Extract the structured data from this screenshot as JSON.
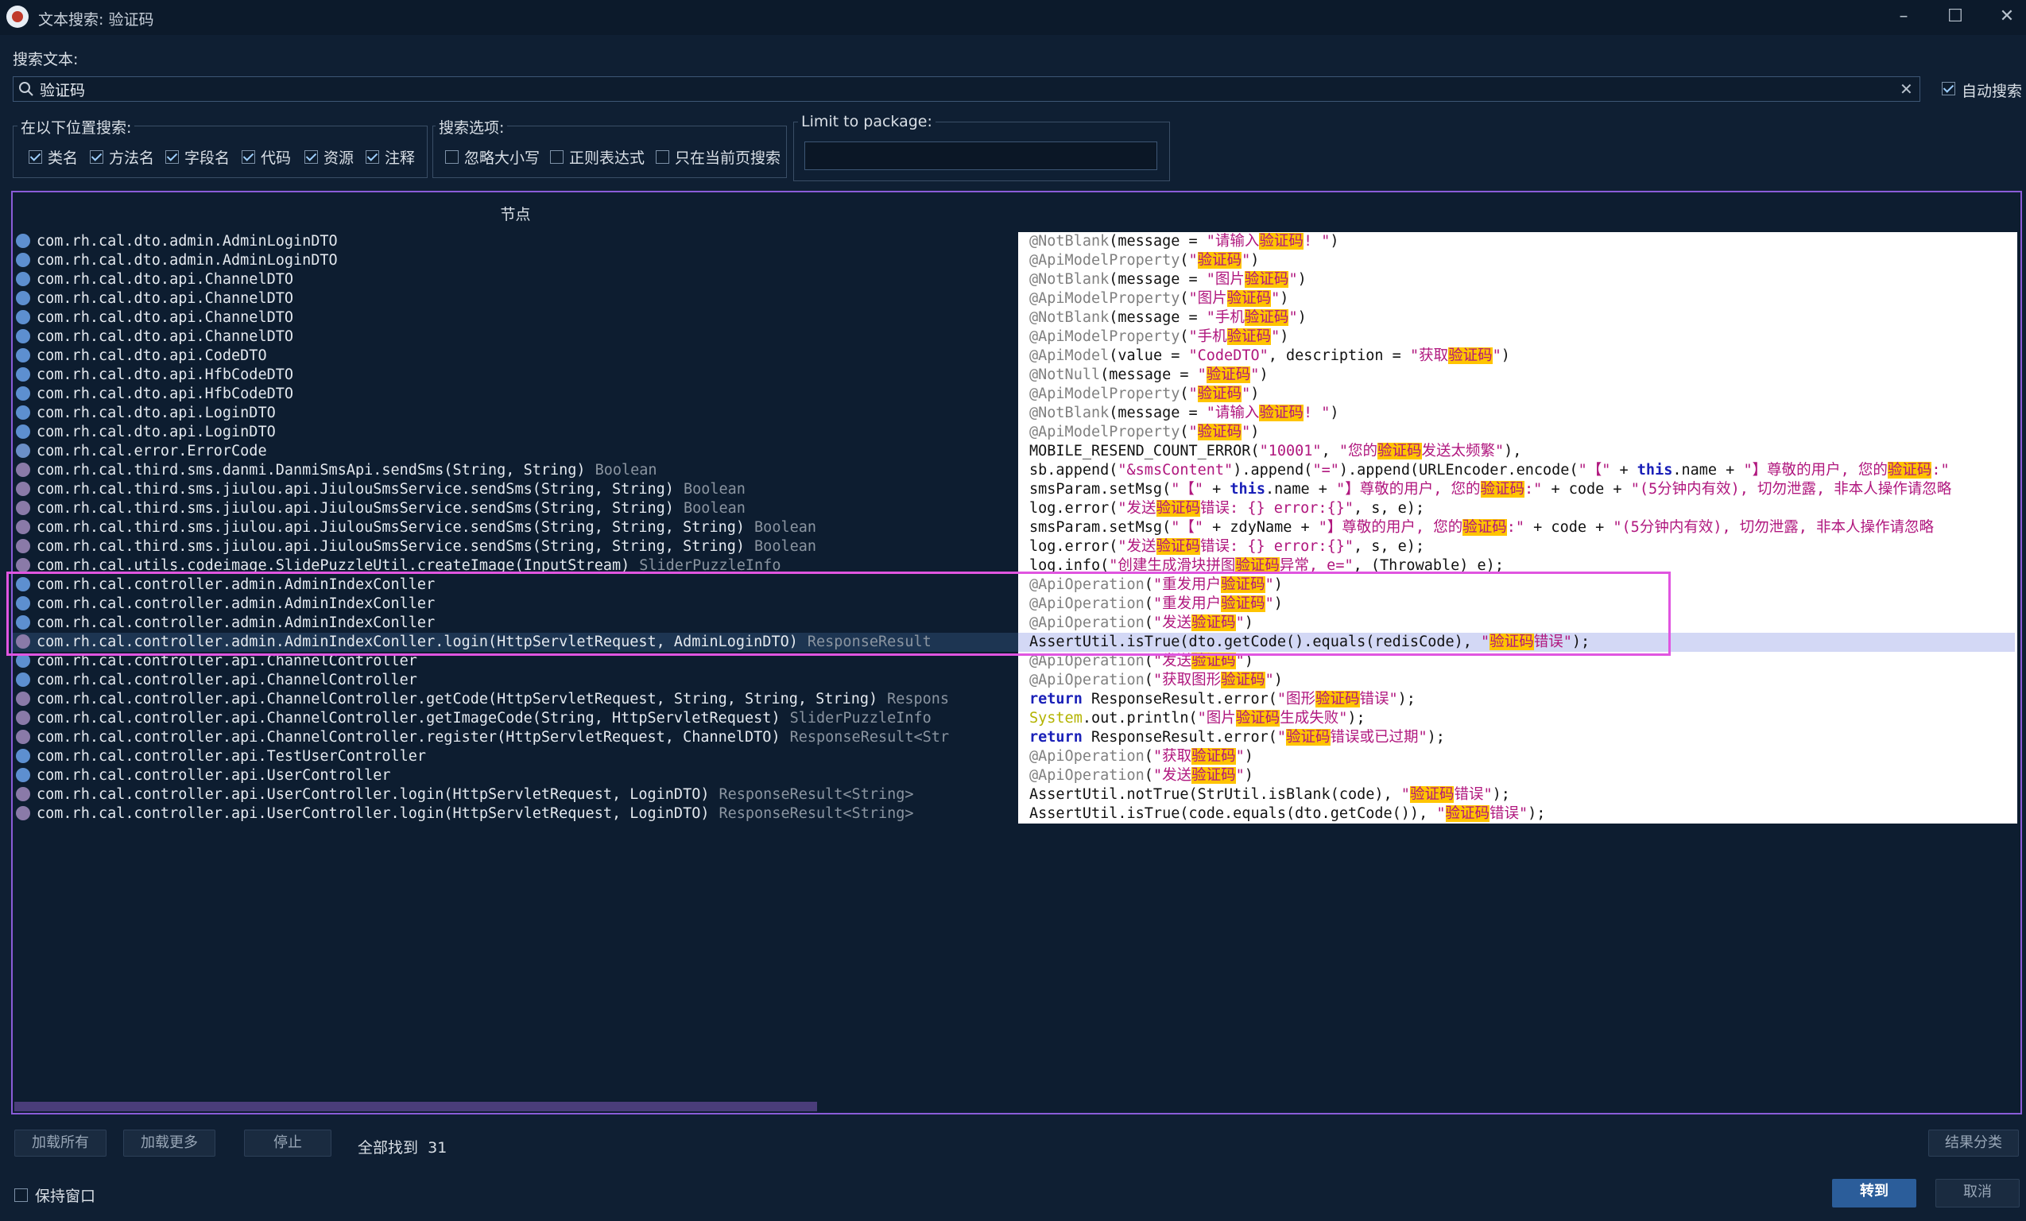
{
  "window": {
    "title": "文本搜索: 验证码"
  },
  "search": {
    "label": "搜索文本:",
    "value": "验证码",
    "auto_search_label": "自动搜索",
    "auto_search_checked": true
  },
  "search_in": {
    "legend": "在以下位置搜索:",
    "options": [
      {
        "label": "类名",
        "checked": true
      },
      {
        "label": "方法名",
        "checked": true
      },
      {
        "label": "字段名",
        "checked": true
      },
      {
        "label": "代码",
        "checked": true
      },
      {
        "label": "资源",
        "checked": true
      },
      {
        "label": "注释",
        "checked": true
      }
    ]
  },
  "search_options": {
    "legend": "搜索选项:",
    "options": [
      {
        "label": "忽略大小写",
        "checked": false
      },
      {
        "label": "正则表达式",
        "checked": false
      },
      {
        "label": "只在当前页搜索",
        "checked": false
      }
    ]
  },
  "package_filter": {
    "legend": "Limit to package:",
    "value": ""
  },
  "results": {
    "column_header": "节点",
    "rows": [
      {
        "icon": "class-icon",
        "node": "com.rh.cal.dto.admin.AdminLoginDTO",
        "ret": ""
      },
      {
        "icon": "class-icon",
        "node": "com.rh.cal.dto.admin.AdminLoginDTO",
        "ret": ""
      },
      {
        "icon": "class-icon",
        "node": "com.rh.cal.dto.api.ChannelDTO",
        "ret": ""
      },
      {
        "icon": "class-icon",
        "node": "com.rh.cal.dto.api.ChannelDTO",
        "ret": ""
      },
      {
        "icon": "class-icon",
        "node": "com.rh.cal.dto.api.ChannelDTO",
        "ret": ""
      },
      {
        "icon": "class-icon",
        "node": "com.rh.cal.dto.api.ChannelDTO",
        "ret": ""
      },
      {
        "icon": "class-icon",
        "node": "com.rh.cal.dto.api.CodeDTO",
        "ret": ""
      },
      {
        "icon": "class-icon",
        "node": "com.rh.cal.dto.api.HfbCodeDTO",
        "ret": ""
      },
      {
        "icon": "class-icon",
        "node": "com.rh.cal.dto.api.HfbCodeDTO",
        "ret": ""
      },
      {
        "icon": "class-icon",
        "node": "com.rh.cal.dto.api.LoginDTO",
        "ret": ""
      },
      {
        "icon": "class-icon",
        "node": "com.rh.cal.dto.api.LoginDTO",
        "ret": ""
      },
      {
        "icon": "enum-icon",
        "node": "com.rh.cal.error.ErrorCode",
        "ret": ""
      },
      {
        "icon": "method-icon",
        "node": "com.rh.cal.third.sms.danmi.DanmiSmsApi.sendSms(String, String)",
        "ret": "Boolean"
      },
      {
        "icon": "method-icon",
        "node": "com.rh.cal.third.sms.jiulou.api.JiulouSmsService.sendSms(String, String)",
        "ret": "Boolean"
      },
      {
        "icon": "method-icon",
        "node": "com.rh.cal.third.sms.jiulou.api.JiulouSmsService.sendSms(String, String)",
        "ret": "Boolean"
      },
      {
        "icon": "method-icon",
        "node": "com.rh.cal.third.sms.jiulou.api.JiulouSmsService.sendSms(String, String, String)",
        "ret": "Boolean"
      },
      {
        "icon": "method-icon",
        "node": "com.rh.cal.third.sms.jiulou.api.JiulouSmsService.sendSms(String, String, String)",
        "ret": "Boolean"
      },
      {
        "icon": "method-icon",
        "node": "com.rh.cal.utils.codeimage.SlidePuzzleUtil.createImage(InputStream)",
        "ret": "SliderPuzzleInfo"
      },
      {
        "icon": "class-icon",
        "node": "com.rh.cal.controller.admin.AdminIndexConller",
        "ret": ""
      },
      {
        "icon": "class-icon",
        "node": "com.rh.cal.controller.admin.AdminIndexConller",
        "ret": ""
      },
      {
        "icon": "class-icon",
        "node": "com.rh.cal.controller.admin.AdminIndexConller",
        "ret": ""
      },
      {
        "icon": "method-icon",
        "node": "com.rh.cal.controller.admin.AdminIndexConller.login(HttpServletRequest, AdminLoginDTO)",
        "ret": "ResponseResult"
      },
      {
        "icon": "class-icon",
        "node": "com.rh.cal.controller.api.ChannelController",
        "ret": ""
      },
      {
        "icon": "class-icon",
        "node": "com.rh.cal.controller.api.ChannelController",
        "ret": ""
      },
      {
        "icon": "method-icon",
        "node": "com.rh.cal.controller.api.ChannelController.getCode(HttpServletRequest, String, String, String)",
        "ret": "Respons"
      },
      {
        "icon": "method-icon",
        "node": "com.rh.cal.controller.api.ChannelController.getImageCode(String, HttpServletRequest)",
        "ret": "SliderPuzzleInfo"
      },
      {
        "icon": "method-icon",
        "node": "com.rh.cal.controller.api.ChannelController.register(HttpServletRequest, ChannelDTO)",
        "ret": "ResponseResult<Str"
      },
      {
        "icon": "class-icon",
        "node": "com.rh.cal.controller.api.TestUserController",
        "ret": ""
      },
      {
        "icon": "class-icon",
        "node": "com.rh.cal.controller.api.UserController",
        "ret": ""
      },
      {
        "icon": "method-icon",
        "node": "com.rh.cal.controller.api.UserController.login(HttpServletRequest, LoginDTO)",
        "ret": "ResponseResult<String>"
      },
      {
        "icon": "method-icon",
        "node": "com.rh.cal.controller.api.UserController.login(HttpServletRequest, LoginDTO)",
        "ret": "ResponseResult<String>"
      }
    ],
    "selected_index": 21,
    "code_lines": [
      [
        [
          "ann",
          "@NotBlank"
        ],
        [
          "n",
          "(message = "
        ],
        [
          "str",
          "\"请输入"
        ],
        [
          "hl",
          "验证码"
        ],
        [
          "str",
          "! \""
        ],
        [
          "n",
          ")"
        ]
      ],
      [
        [
          "ann",
          "@ApiModelProperty"
        ],
        [
          "n",
          "("
        ],
        [
          "str",
          "\""
        ],
        [
          "hl",
          "验证码"
        ],
        [
          "str",
          "\""
        ],
        [
          "n",
          ")"
        ]
      ],
      [
        [
          "ann",
          "@NotBlank"
        ],
        [
          "n",
          "(message = "
        ],
        [
          "str",
          "\"图片"
        ],
        [
          "hl",
          "验证码"
        ],
        [
          "str",
          "\""
        ],
        [
          "n",
          ")"
        ]
      ],
      [
        [
          "ann",
          "@ApiModelProperty"
        ],
        [
          "n",
          "("
        ],
        [
          "str",
          "\"图片"
        ],
        [
          "hl",
          "验证码"
        ],
        [
          "str",
          "\""
        ],
        [
          "n",
          ")"
        ]
      ],
      [
        [
          "ann",
          "@NotBlank"
        ],
        [
          "n",
          "(message = "
        ],
        [
          "str",
          "\"手机"
        ],
        [
          "hl",
          "验证码"
        ],
        [
          "str",
          "\""
        ],
        [
          "n",
          ")"
        ]
      ],
      [
        [
          "ann",
          "@ApiModelProperty"
        ],
        [
          "n",
          "("
        ],
        [
          "str",
          "\"手机"
        ],
        [
          "hl",
          "验证码"
        ],
        [
          "str",
          "\""
        ],
        [
          "n",
          ")"
        ]
      ],
      [
        [
          "ann",
          "@ApiModel"
        ],
        [
          "n",
          "(value = "
        ],
        [
          "str",
          "\"CodeDTO\""
        ],
        [
          "n",
          ", description = "
        ],
        [
          "str",
          "\"获取"
        ],
        [
          "hl",
          "验证码"
        ],
        [
          "str",
          "\""
        ],
        [
          "n",
          ")"
        ]
      ],
      [
        [
          "ann",
          "@NotNull"
        ],
        [
          "n",
          "(message = "
        ],
        [
          "str",
          "\""
        ],
        [
          "hl",
          "验证码"
        ],
        [
          "str",
          "\""
        ],
        [
          "n",
          ")"
        ]
      ],
      [
        [
          "ann",
          "@ApiModelProperty"
        ],
        [
          "n",
          "("
        ],
        [
          "str",
          "\""
        ],
        [
          "hl",
          "验证码"
        ],
        [
          "str",
          "\""
        ],
        [
          "n",
          ")"
        ]
      ],
      [
        [
          "ann",
          "@NotBlank"
        ],
        [
          "n",
          "(message = "
        ],
        [
          "str",
          "\"请输入"
        ],
        [
          "hl",
          "验证码"
        ],
        [
          "str",
          "! \""
        ],
        [
          "n",
          ")"
        ]
      ],
      [
        [
          "ann",
          "@ApiModelProperty"
        ],
        [
          "n",
          "("
        ],
        [
          "str",
          "\""
        ],
        [
          "hl",
          "验证码"
        ],
        [
          "str",
          "\""
        ],
        [
          "n",
          ")"
        ]
      ],
      [
        [
          "n",
          "MOBILE_RESEND_COUNT_ERROR("
        ],
        [
          "str",
          "\"10001\""
        ],
        [
          "n",
          ", "
        ],
        [
          "str",
          "\"您的"
        ],
        [
          "hl",
          "验证码"
        ],
        [
          "str",
          "发送太频繁\""
        ],
        [
          "n",
          "),"
        ]
      ],
      [
        [
          "n",
          "sb.append("
        ],
        [
          "str",
          "\"&smsContent\""
        ],
        [
          "n",
          ").append("
        ],
        [
          "str",
          "\"=\""
        ],
        [
          "n",
          ").append(URLEncoder.encode("
        ],
        [
          "str",
          "\"【\""
        ],
        [
          "n",
          " + "
        ],
        [
          "kw",
          "this"
        ],
        [
          "n",
          ".name + "
        ],
        [
          "str",
          "\"】尊敬的用户, 您的"
        ],
        [
          "hl",
          "验证码"
        ],
        [
          "str",
          ":\""
        ]
      ],
      [
        [
          "n",
          "smsParam.setMsg("
        ],
        [
          "str",
          "\"【\""
        ],
        [
          "n",
          " + "
        ],
        [
          "kw",
          "this"
        ],
        [
          "n",
          ".name + "
        ],
        [
          "str",
          "\"】尊敬的用户, 您的"
        ],
        [
          "hl",
          "验证码"
        ],
        [
          "str",
          ":\""
        ],
        [
          "n",
          " + code + "
        ],
        [
          "str",
          "\"(5分钟内有效), 切勿泄露, 非本人操作请忽略"
        ]
      ],
      [
        [
          "n",
          "log.error("
        ],
        [
          "str",
          "\"发送"
        ],
        [
          "hl",
          "验证码"
        ],
        [
          "str",
          "错误: {} error:{}\""
        ],
        [
          "n",
          ", s, e);"
        ]
      ],
      [
        [
          "n",
          "smsParam.setMsg("
        ],
        [
          "str",
          "\"【\""
        ],
        [
          "n",
          " + zdyName + "
        ],
        [
          "str",
          "\"】尊敬的用户, 您的"
        ],
        [
          "hl",
          "验证码"
        ],
        [
          "str",
          ":\""
        ],
        [
          "n",
          " + code + "
        ],
        [
          "str",
          "\"(5分钟内有效), 切勿泄露, 非本人操作请忽略"
        ]
      ],
      [
        [
          "n",
          "log.error("
        ],
        [
          "str",
          "\"发送"
        ],
        [
          "hl",
          "验证码"
        ],
        [
          "str",
          "错误: {} error:{}\""
        ],
        [
          "n",
          ", s, e);"
        ]
      ],
      [
        [
          "n",
          "log.info("
        ],
        [
          "str",
          "\"创建生成滑块拼图"
        ],
        [
          "hl",
          "验证码"
        ],
        [
          "str",
          "异常, e=\""
        ],
        [
          "n",
          ", (Throwable) e);"
        ]
      ],
      [
        [
          "ann",
          "@ApiOperation"
        ],
        [
          "n",
          "("
        ],
        [
          "str",
          "\"重发用户"
        ],
        [
          "hl",
          "验证码"
        ],
        [
          "str",
          "\""
        ],
        [
          "n",
          ")"
        ]
      ],
      [
        [
          "ann",
          "@ApiOperation"
        ],
        [
          "n",
          "("
        ],
        [
          "str",
          "\"重发用户"
        ],
        [
          "hl",
          "验证码"
        ],
        [
          "str",
          "\""
        ],
        [
          "n",
          ")"
        ]
      ],
      [
        [
          "ann",
          "@ApiOperation"
        ],
        [
          "n",
          "("
        ],
        [
          "str",
          "\"发送"
        ],
        [
          "hl",
          "验证码"
        ],
        [
          "str",
          "\""
        ],
        [
          "n",
          ")"
        ]
      ],
      [
        [
          "n",
          "AssertUtil.isTrue(dto.getCode().equals(redisCode), "
        ],
        [
          "str",
          "\""
        ],
        [
          "hl",
          "验证码"
        ],
        [
          "str",
          "错误\""
        ],
        [
          "n",
          ");"
        ]
      ],
      [
        [
          "ann",
          "@ApiOperation"
        ],
        [
          "n",
          "("
        ],
        [
          "str",
          "\"发送"
        ],
        [
          "hl",
          "验证码"
        ],
        [
          "str",
          "\""
        ],
        [
          "n",
          ")"
        ]
      ],
      [
        [
          "ann",
          "@ApiOperation"
        ],
        [
          "n",
          "("
        ],
        [
          "str",
          "\"获取图形"
        ],
        [
          "hl",
          "验证码"
        ],
        [
          "str",
          "\""
        ],
        [
          "n",
          ")"
        ]
      ],
      [
        [
          "kw",
          "return"
        ],
        [
          "n",
          " ResponseResult.error("
        ],
        [
          "str",
          "\"图形"
        ],
        [
          "hl",
          "验证码"
        ],
        [
          "str",
          "错误\""
        ],
        [
          "n",
          ");"
        ]
      ],
      [
        [
          "sys",
          "System"
        ],
        [
          "n",
          ".out.println("
        ],
        [
          "str",
          "\"图片"
        ],
        [
          "hl",
          "验证码"
        ],
        [
          "str",
          "生成失败\""
        ],
        [
          "n",
          ");"
        ]
      ],
      [
        [
          "kw",
          "return"
        ],
        [
          "n",
          " ResponseResult.error("
        ],
        [
          "str",
          "\""
        ],
        [
          "hl",
          "验证码"
        ],
        [
          "str",
          "错误或已过期\""
        ],
        [
          "n",
          ");"
        ]
      ],
      [
        [
          "ann",
          "@ApiOperation"
        ],
        [
          "n",
          "("
        ],
        [
          "str",
          "\"获取"
        ],
        [
          "hl",
          "验证码"
        ],
        [
          "str",
          "\""
        ],
        [
          "n",
          ")"
        ]
      ],
      [
        [
          "ann",
          "@ApiOperation"
        ],
        [
          "n",
          "("
        ],
        [
          "str",
          "\"发送"
        ],
        [
          "hl",
          "验证码"
        ],
        [
          "str",
          "\""
        ],
        [
          "n",
          ")"
        ]
      ],
      [
        [
          "n",
          "AssertUtil.notTrue(StrUtil.isBlank(code), "
        ],
        [
          "str",
          "\""
        ],
        [
          "hl",
          "验证码"
        ],
        [
          "str",
          "错误\""
        ],
        [
          "n",
          ");"
        ]
      ],
      [
        [
          "n",
          "AssertUtil.isTrue(code.equals(dto.getCode()), "
        ],
        [
          "str",
          "\""
        ],
        [
          "hl",
          "验证码"
        ],
        [
          "str",
          "错误\""
        ],
        [
          "n",
          ");"
        ]
      ]
    ]
  },
  "footer": {
    "load_all": "加载所有",
    "load_more": "加载更多",
    "stop": "停止",
    "found_label": "全部找到",
    "found_count": "31",
    "sort_results": "结果分类",
    "keep_window": "保持窗口",
    "goto": "转到",
    "cancel": "取消"
  },
  "colors": {
    "accent": "#2b5d9a",
    "highlight": "#ffc400",
    "annotation_box": "#e055e0",
    "panel_border": "#8a5cd8"
  }
}
